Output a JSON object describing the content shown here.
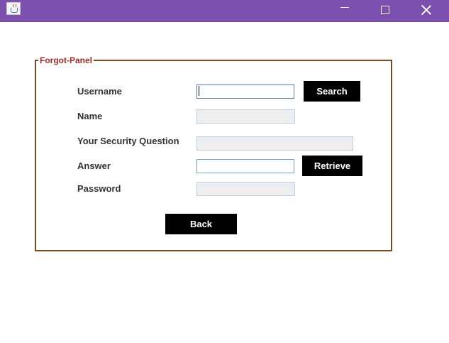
{
  "window": {
    "icon": "java-cup-icon",
    "controls": {
      "minimize_icon": "minimize-icon",
      "maximize_icon": "maximize-icon",
      "close_icon": "close-icon"
    },
    "titlebar_color": "#7b4fad"
  },
  "panel": {
    "title": "Forgot-Panel",
    "border_color": "#7a4a22",
    "title_color": "#a32a2a"
  },
  "form": {
    "username_label": "Username",
    "username_value": "",
    "name_label": "Name",
    "name_value": "",
    "question_label": "Your Security Question",
    "question_value": "",
    "answer_label": "Answer",
    "answer_value": "",
    "password_label": "Password",
    "password_value": ""
  },
  "buttons": {
    "search": "Search",
    "retrieve": "Retrieve",
    "back": "Back",
    "color": "#000000"
  }
}
